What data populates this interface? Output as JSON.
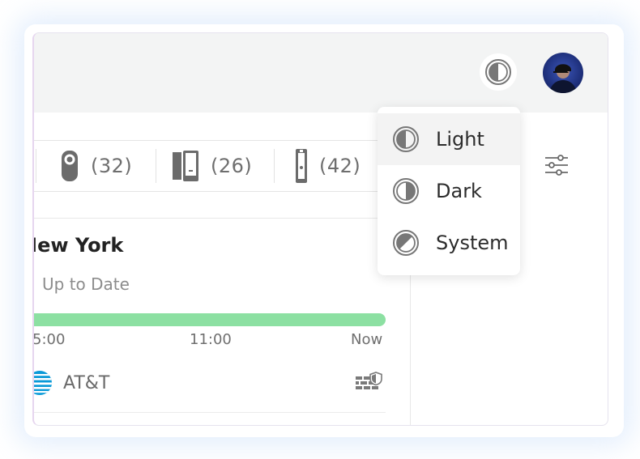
{
  "header": {
    "theme_toggle_icon": "half-circle-theme-icon",
    "avatar": "user-avatar"
  },
  "devices": [
    {
      "icon": "camera-device-icon",
      "count": "(32)"
    },
    {
      "icon": "panel-device-icon",
      "count": "(26)"
    },
    {
      "icon": "doorbell-device-icon",
      "count": "(42)"
    }
  ],
  "location": {
    "city": "New York",
    "status": "Up to Date",
    "progress_pct": 100,
    "progress_color": "#8ce0a2",
    "timeline_ticks": [
      "5:00",
      "11:00",
      "Now"
    ],
    "carrier": "AT&T",
    "carrier_icon": "att-globe-icon",
    "security_icon": "firewall-shield-icon"
  },
  "filter_icon": "sliders-filter-icon",
  "theme_menu": {
    "items": [
      {
        "label": "Light",
        "icon": "theme-light-icon",
        "active": true
      },
      {
        "label": "Dark",
        "icon": "theme-dark-icon",
        "active": false
      },
      {
        "label": "System",
        "icon": "theme-system-icon",
        "active": false
      }
    ]
  }
}
